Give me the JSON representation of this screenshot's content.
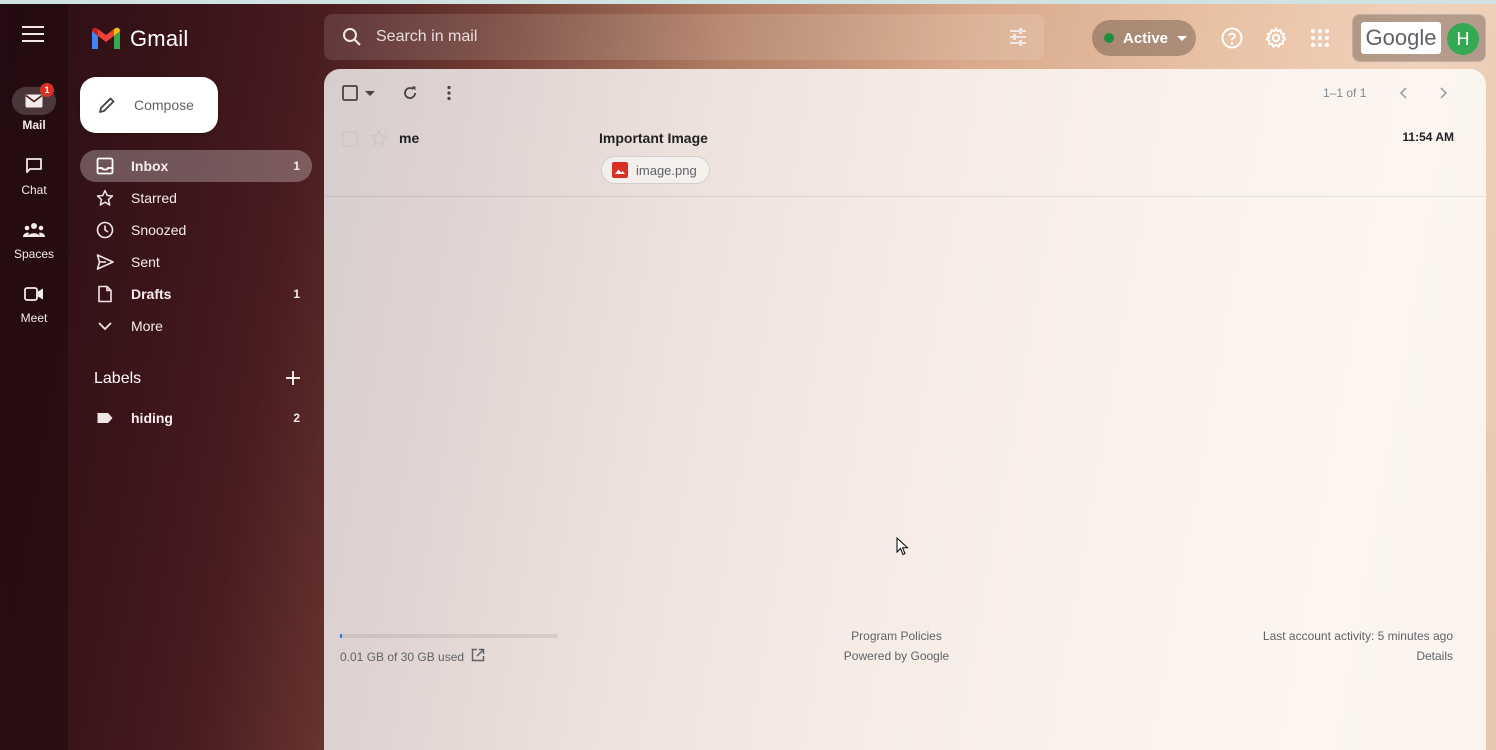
{
  "app": {
    "name": "Gmail"
  },
  "rail": {
    "items": [
      {
        "label": "Mail",
        "icon": "mail-icon",
        "badge": "1"
      },
      {
        "label": "Chat",
        "icon": "chat-icon"
      },
      {
        "label": "Spaces",
        "icon": "spaces-icon"
      },
      {
        "label": "Meet",
        "icon": "meet-icon"
      }
    ]
  },
  "search": {
    "placeholder": "Search in mail"
  },
  "status": {
    "label": "Active",
    "color": "#1e8e3e"
  },
  "account": {
    "brand": "Google",
    "avatar_letter": "H"
  },
  "compose": {
    "label": "Compose"
  },
  "nav": {
    "items": [
      {
        "label": "Inbox",
        "count": "1",
        "icon": "inbox-icon"
      },
      {
        "label": "Starred",
        "count": "",
        "icon": "star-icon"
      },
      {
        "label": "Snoozed",
        "count": "",
        "icon": "clock-icon"
      },
      {
        "label": "Sent",
        "count": "",
        "icon": "send-icon"
      },
      {
        "label": "Drafts",
        "count": "1",
        "icon": "draft-icon"
      },
      {
        "label": "More",
        "count": "",
        "icon": "chevron-down-icon"
      }
    ]
  },
  "labels": {
    "heading": "Labels",
    "items": [
      {
        "label": "hiding",
        "count": "2"
      }
    ]
  },
  "list": {
    "range": "1–1 of 1",
    "emails": [
      {
        "sender": "me",
        "subject": "Important Image",
        "time": "11:54 AM",
        "attachment": "image.png"
      }
    ]
  },
  "footer": {
    "storage": "0.01 GB of 30 GB used",
    "storage_fraction": 0.0003,
    "program_policies": "Program Policies",
    "powered_by": "Powered by Google",
    "last_activity": "Last account activity: 5 minutes ago",
    "details": "Details"
  }
}
